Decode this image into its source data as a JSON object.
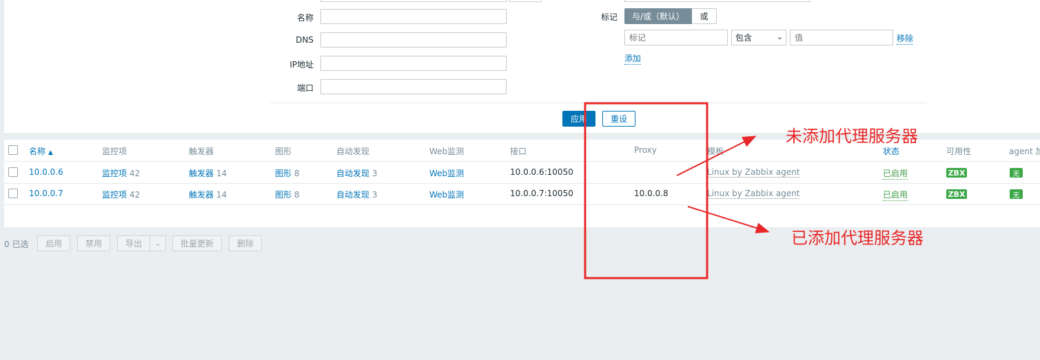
{
  "filter": {
    "name_label": "名称",
    "dns_label": "DNS",
    "ip_label": "IP地址",
    "port_label": "端口",
    "name_value": "",
    "dns_value": "",
    "ip_value": "",
    "port_value": "",
    "tags_label": "标记",
    "tag_mode_andor": "与/或（默认）",
    "tag_mode_or": "或",
    "tag_placeholder": "标记",
    "tag_operator": "包含",
    "value_placeholder": "值",
    "remove_link": "移除",
    "add_link": "添加",
    "apply_button": "应用",
    "reset_button": "重设"
  },
  "table": {
    "headers": {
      "name": "名称",
      "sort_indicator": "▲",
      "items": "监控项",
      "triggers": "触发器",
      "graphs": "图形",
      "discovery": "自动发现",
      "web": "Web监测",
      "interface": "接口",
      "proxy": "Proxy",
      "templates": "模板",
      "status": "状态",
      "availability": "可用性",
      "agent_encryption": "agent 加"
    },
    "rows": [
      {
        "name": "10.0.0.6",
        "items_label": "监控项",
        "items_count": "42",
        "triggers_label": "触发器",
        "triggers_count": "14",
        "graphs_label": "图形",
        "graphs_count": "8",
        "discovery_label": "自动发现",
        "discovery_count": "3",
        "web_label": "Web监测",
        "interface": "10.0.0.6:10050",
        "proxy": "",
        "template": "Linux by Zabbix agent",
        "status": "已启用",
        "availability": "ZBX",
        "encryption": "无"
      },
      {
        "name": "10.0.0.7",
        "items_label": "监控项",
        "items_count": "42",
        "triggers_label": "触发器",
        "triggers_count": "14",
        "graphs_label": "图形",
        "graphs_count": "8",
        "discovery_label": "自动发现",
        "discovery_count": "3",
        "web_label": "Web监测",
        "interface": "10.0.0.7:10050",
        "proxy": "10.0.0.8",
        "template": "Linux by Zabbix agent",
        "status": "已启用",
        "availability": "ZBX",
        "encryption": "无"
      }
    ]
  },
  "actions": {
    "selected_count": "0 已选",
    "enable": "启用",
    "disable": "禁用",
    "export": "导出",
    "mass_update": "批量更新",
    "delete": "删除"
  },
  "annotations": {
    "no_proxy": "未添加代理服务器",
    "with_proxy": "已添加代理服务器",
    "color": "#e82828"
  },
  "colors": {
    "link": "#0275b8",
    "status_enabled": "#429e47",
    "badge_green": "#3ca848",
    "segment_active": "#768d99"
  }
}
